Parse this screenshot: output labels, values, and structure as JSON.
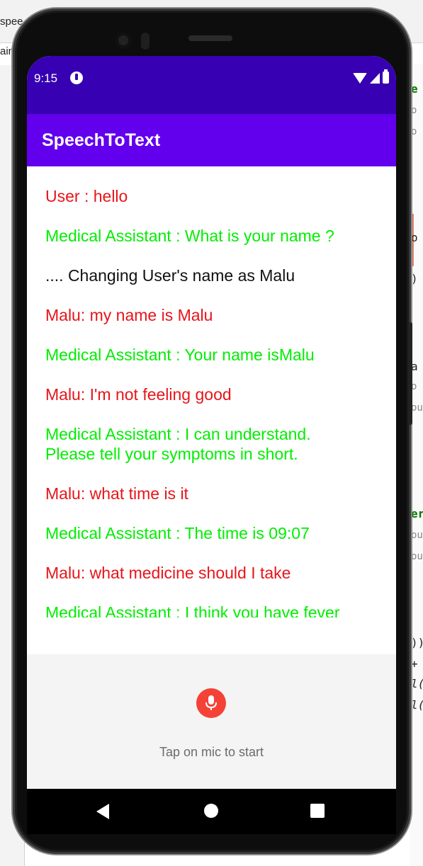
{
  "ide": {
    "tab_top": "spee",
    "tab_second": "ain",
    "code_lines": [
      "e",
      "o",
      "o",
      "o",
      ")",
      "a",
      "o",
      "ou",
      "er",
      "ou",
      "ou",
      "))",
      "+",
      "l(",
      "l("
    ]
  },
  "status_bar": {
    "time": "9:15"
  },
  "app_bar": {
    "title": "SpeechToText"
  },
  "chat": {
    "messages": [
      {
        "role": "user",
        "text": "User : hello"
      },
      {
        "role": "assistant",
        "text": "Medical Assistant : What is your name ?"
      },
      {
        "role": "system",
        "text": ".... Changing User's name as Malu"
      },
      {
        "role": "user",
        "text": "Malu: my name is Malu"
      },
      {
        "role": "assistant",
        "text": "Medical Assistant : Your name isMalu"
      },
      {
        "role": "user",
        "text": "Malu: I'm not feeling good"
      },
      {
        "role": "assistant",
        "text": "Medical Assistant : I can understand. Please tell your symptoms in short."
      },
      {
        "role": "user",
        "text": "Malu: what time is it"
      },
      {
        "role": "assistant",
        "text": "Medical Assistant : The time is 09:07"
      },
      {
        "role": "user",
        "text": "Malu: what medicine should I take"
      },
      {
        "role": "assistant",
        "text": "Medical Assistant : I think you have fever"
      }
    ]
  },
  "controls": {
    "mic_icon": "microphone-icon",
    "hint": "Tap on mic to start"
  },
  "nav": {
    "back_icon": "back-triangle-icon",
    "home_icon": "home-circle-icon",
    "recents_icon": "recents-square-icon"
  },
  "colors": {
    "status_bar": "#3700b3",
    "app_bar": "#6200ee",
    "user_text": "#e8141a",
    "assistant_text": "#00ee00",
    "mic_button": "#f44336"
  }
}
